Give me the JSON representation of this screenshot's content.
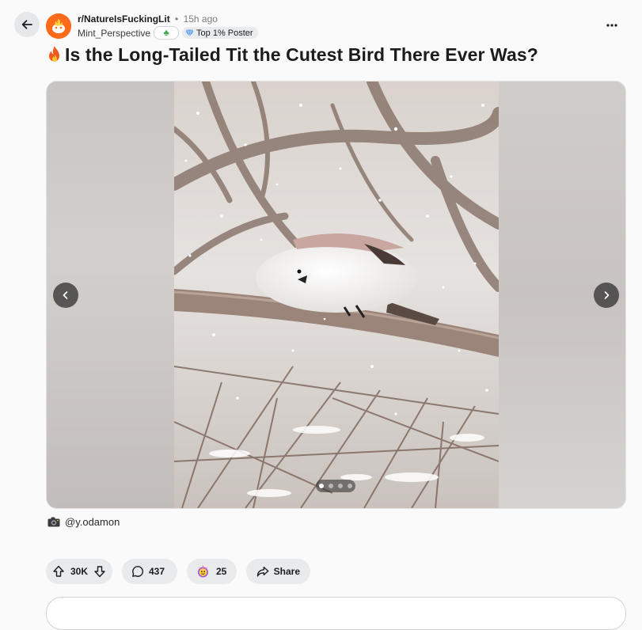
{
  "post": {
    "subreddit": "r/NatureIsFuckingLit",
    "separator": "•",
    "age": "15h ago",
    "author": "Mint_Perspective",
    "flair_clover": "♣",
    "flair_top": "Top 1% Poster",
    "title": "Is the Long-Tailed Tit the Cutest Bird There Ever Was?",
    "caption": "@y.odamon"
  },
  "gallery": {
    "image_count": 4,
    "active_index": 0
  },
  "actions": {
    "votes": "30K",
    "comments": "437",
    "awards": "25",
    "share": "Share"
  },
  "colors": {
    "brand_orange": "#ff6a1a",
    "pill_bg": "#e8eaec",
    "page_bg": "#fafafa"
  },
  "icons": [
    "back-arrow-icon",
    "subreddit-avatar-icon",
    "clover-icon",
    "diamond-icon",
    "more-options-icon",
    "fire-icon",
    "chevron-left-icon",
    "chevron-right-icon",
    "camera-icon",
    "upvote-icon",
    "downvote-icon",
    "comment-icon",
    "award-icon",
    "share-icon"
  ]
}
